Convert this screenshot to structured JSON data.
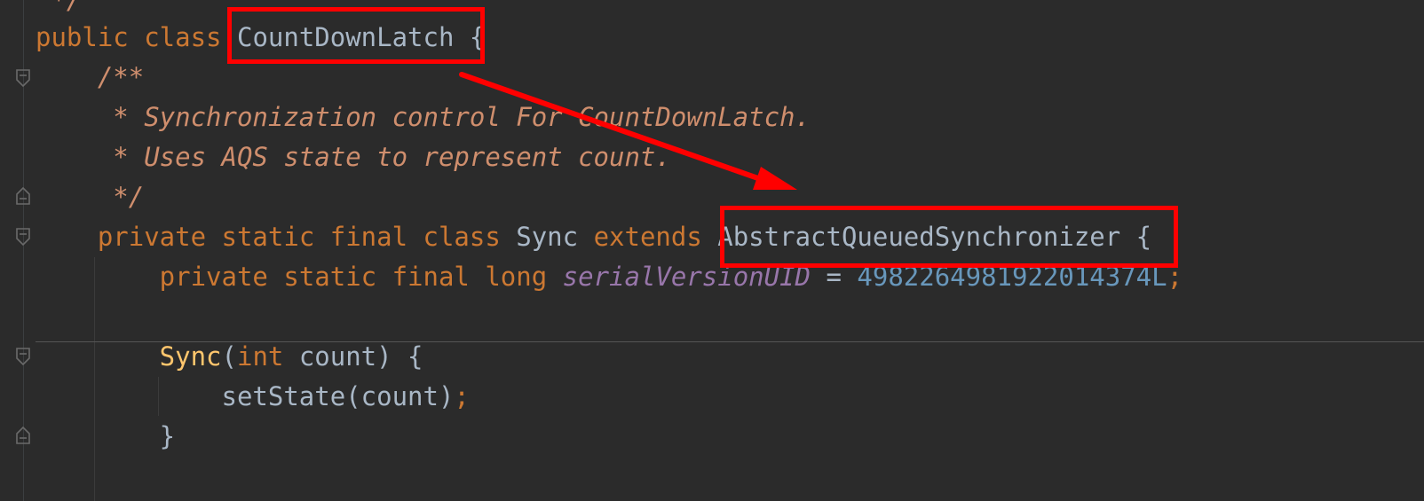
{
  "editor": {
    "lines": [
      {
        "id": "l0",
        "parts": [
          {
            "t": " */",
            "c": "doc"
          }
        ]
      },
      {
        "id": "l1",
        "parts": [
          {
            "t": "public ",
            "c": "kw"
          },
          {
            "t": "class ",
            "c": "kw"
          },
          {
            "t": "CountDownLatch",
            "c": "cls"
          },
          {
            "t": " {",
            "c": "punct"
          }
        ]
      },
      {
        "id": "l2",
        "parts": [
          {
            "t": "    /**",
            "c": "doc"
          }
        ]
      },
      {
        "id": "l3",
        "parts": [
          {
            "t": "     * Synchronization control For CountDownLatch.",
            "c": "doc"
          }
        ]
      },
      {
        "id": "l4",
        "parts": [
          {
            "t": "     * Uses AQS state to represent count.",
            "c": "doc"
          }
        ]
      },
      {
        "id": "l5",
        "parts": [
          {
            "t": "     */",
            "c": "doc"
          }
        ]
      },
      {
        "id": "l6",
        "parts": [
          {
            "t": "    private ",
            "c": "kw"
          },
          {
            "t": "static ",
            "c": "kw"
          },
          {
            "t": "final ",
            "c": "kw"
          },
          {
            "t": "class ",
            "c": "kw"
          },
          {
            "t": "Sync ",
            "c": "cls"
          },
          {
            "t": "extends ",
            "c": "kw"
          },
          {
            "t": "AbstractQueuedSynchronizer",
            "c": "cls"
          },
          {
            "t": " {",
            "c": "punct"
          }
        ]
      },
      {
        "id": "l7",
        "parts": [
          {
            "t": "        private ",
            "c": "kw"
          },
          {
            "t": "static ",
            "c": "kw"
          },
          {
            "t": "final ",
            "c": "kw"
          },
          {
            "t": "long ",
            "c": "kw"
          },
          {
            "t": "serialVersionUID",
            "c": "field"
          },
          {
            "t": " = ",
            "c": "punct"
          },
          {
            "t": "4982264981922014374L",
            "c": "num"
          },
          {
            "t": ";",
            "c": "semi"
          }
        ]
      },
      {
        "id": "l8",
        "parts": [
          {
            "t": "",
            "c": "punct"
          }
        ]
      },
      {
        "id": "l9",
        "parts": [
          {
            "t": "        Sync",
            "c": "fn"
          },
          {
            "t": "(",
            "c": "punct"
          },
          {
            "t": "int ",
            "c": "kw"
          },
          {
            "t": "count) {",
            "c": "punct"
          }
        ]
      },
      {
        "id": "l10",
        "parts": [
          {
            "t": "            setState(count)",
            "c": "punct"
          },
          {
            "t": ";",
            "c": "semi"
          }
        ]
      },
      {
        "id": "l11",
        "parts": [
          {
            "t": "        }",
            "c": "punct"
          }
        ]
      }
    ]
  },
  "annotations": {
    "box_color": "#ff0000",
    "arrow_color": "#ff0000"
  }
}
